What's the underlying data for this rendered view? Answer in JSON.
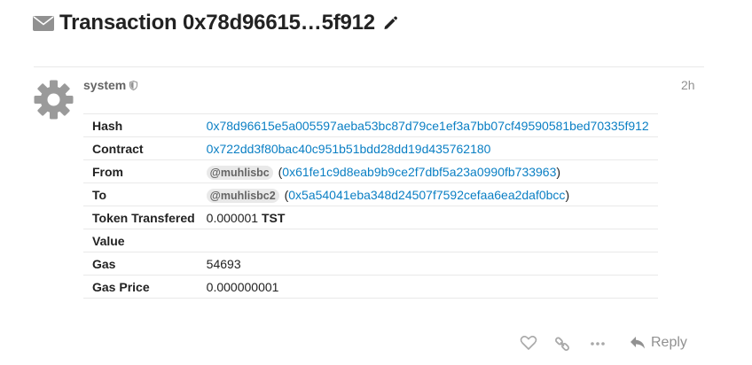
{
  "topic": {
    "title": "Transaction 0x78d96615…5f912",
    "category_icon": "envelope-icon",
    "edit_icon": "pencil-icon"
  },
  "post": {
    "username": "system",
    "user_icon": "shield-icon",
    "time": "2h",
    "rows": [
      {
        "label": "Hash",
        "value": "0x78d96615e5a005597aeba53bc87d79ce1ef3a7bb07cf49590581bed70335f912"
      },
      {
        "label": "Contract",
        "value": "0x722dd3f80bac40c951b51bdd28dd19d435762180"
      },
      {
        "label": "From",
        "mention": "@muhlisbc",
        "address": "0x61fe1c9d8eab9b9ce2f7dbf5a23a0990fb733963"
      },
      {
        "label": "To",
        "mention": "@muhlisbc2",
        "address": "0x5a54041eba348d24507f7592cefaa6ea2daf0bcc"
      },
      {
        "label": "Token Transfered",
        "amount": "0.000001",
        "symbol": "TST"
      },
      {
        "label": "Value",
        "value": ""
      },
      {
        "label": "Gas",
        "value": "54693"
      },
      {
        "label": "Gas Price",
        "value": "0.000000001"
      }
    ]
  },
  "actions": {
    "like_icon": "heart-icon",
    "share_icon": "link-icon",
    "more_icon": "ellipsis-icon",
    "reply_label": "Reply",
    "reply_icon": "reply-arrow-icon"
  },
  "colors": {
    "link": "#0a7fc4",
    "muted": "#919191",
    "text": "#222222"
  }
}
